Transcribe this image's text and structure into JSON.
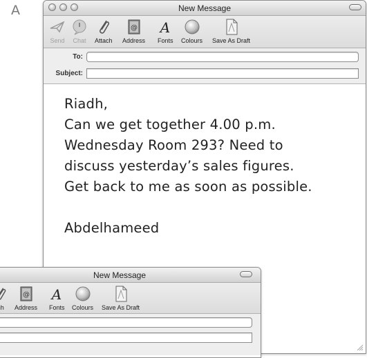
{
  "figure_label": "A",
  "window": {
    "title": "New Message",
    "toolbar": {
      "send": "Send",
      "chat": "Chat",
      "attach": "Attach",
      "address": "Address",
      "fonts": "Fonts",
      "colours": "Colours",
      "save_as_draft": "Save As Draft"
    },
    "fields": {
      "to_label": "To:",
      "to_value": "",
      "subject_label": "Subject:",
      "subject_value": ""
    },
    "body": {
      "lines": [
        "Riadh,",
        "Can we get together 4.00 p.m.",
        "Wednesday Room 293? Need to",
        "discuss yesterday’s sales figures.",
        "Get back to me as soon as possible."
      ],
      "signature": "Abdelhameed"
    }
  },
  "second_window": {
    "title": "New Message",
    "toolbar": {
      "attach_partial": "ch",
      "address": "Address",
      "fonts": "Fonts",
      "colours": "Colours",
      "save_as_draft": "Save As Draft"
    },
    "fields": {
      "to_value": "",
      "subject_value": ""
    }
  }
}
